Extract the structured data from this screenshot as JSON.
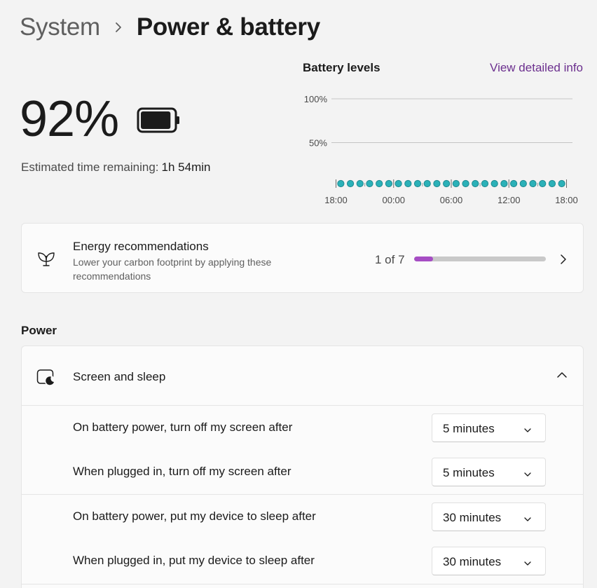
{
  "breadcrumb": {
    "parent": "System",
    "separator_icon": "chevron-right-icon",
    "current": "Power & battery"
  },
  "battery": {
    "percent": "92%",
    "level": 0.92,
    "estimate_label": "Estimated time remaining:",
    "estimate_value": "1h 54min"
  },
  "chart_data": {
    "type": "scatter",
    "title": "Battery levels",
    "ytick_labels": [
      "100%",
      "50%"
    ],
    "xtick_labels": [
      "18:00",
      "00:00",
      "06:00",
      "12:00",
      "18:00"
    ],
    "ylim": [
      0,
      100
    ],
    "x_hours_from_start": [
      0.5,
      1.5,
      2.5,
      3.5,
      4.5,
      5.5,
      6.5,
      7.5,
      8.5,
      9.5,
      10.5,
      11.5,
      12.5,
      13.5,
      14.5,
      15.5,
      16.5,
      17.5,
      18.5,
      19.5,
      20.5,
      21.5,
      22.5,
      23.5
    ],
    "values": [
      0,
      0,
      0,
      0,
      0,
      0,
      0,
      0,
      0,
      0,
      0,
      0,
      0,
      0,
      0,
      0,
      0,
      0,
      0,
      0,
      0,
      0,
      0,
      0
    ],
    "point_color": "#2bb1b8",
    "grid": true
  },
  "links": {
    "view_detailed": "View detailed info"
  },
  "energy": {
    "icon": "leaf-icon",
    "title": "Energy recommendations",
    "description": "Lower your carbon footprint by applying these recommendations",
    "count": "1 of 7",
    "progress": 0.142857,
    "accent": "#a64dc4"
  },
  "power_section": {
    "title": "Power",
    "screen_sleep": {
      "icon": "screen-sleep-icon",
      "title": "Screen and sleep",
      "settings": [
        {
          "label": "On battery power, turn off my screen after",
          "value": "5 minutes"
        },
        {
          "label": "When plugged in, turn off my screen after",
          "value": "5 minutes"
        },
        {
          "label": "On battery power, put my device to sleep after",
          "value": "30 minutes"
        },
        {
          "label": "When plugged in, put my device to sleep after",
          "value": "30 minutes"
        }
      ]
    }
  }
}
